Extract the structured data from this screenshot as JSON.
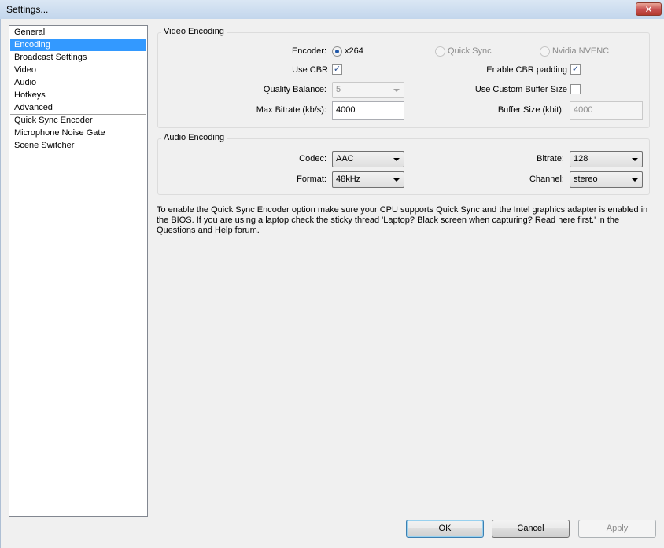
{
  "window": {
    "title": "Settings...",
    "close_glyph": "✕"
  },
  "sidebar": {
    "items": [
      {
        "label": "General"
      },
      {
        "label": "Encoding"
      },
      {
        "label": "Broadcast Settings"
      },
      {
        "label": "Video"
      },
      {
        "label": "Audio"
      },
      {
        "label": "Hotkeys"
      },
      {
        "label": "Advanced"
      },
      {
        "label": "Quick Sync Encoder"
      },
      {
        "label": "Microphone Noise Gate"
      },
      {
        "label": "Scene Switcher"
      }
    ],
    "selected_index": 1
  },
  "video_encoding": {
    "title": "Video Encoding",
    "encoder_label": "Encoder:",
    "encoder_options": [
      {
        "label": "x264",
        "selected": true,
        "enabled": true
      },
      {
        "label": "Quick Sync",
        "selected": false,
        "enabled": false
      },
      {
        "label": "Nvidia NVENC",
        "selected": false,
        "enabled": false
      }
    ],
    "use_cbr_label": "Use CBR",
    "use_cbr_checked": true,
    "enable_cbr_padding_label": "Enable CBR padding",
    "enable_cbr_padding_checked": true,
    "quality_balance_label": "Quality Balance:",
    "quality_balance_value": "5",
    "use_custom_buffer_label": "Use Custom Buffer Size",
    "use_custom_buffer_checked": false,
    "max_bitrate_label": "Max Bitrate (kb/s):",
    "max_bitrate_value": "4000",
    "buffer_size_label": "Buffer Size (kbit):",
    "buffer_size_value": "4000"
  },
  "audio_encoding": {
    "title": "Audio Encoding",
    "codec_label": "Codec:",
    "codec_value": "AAC",
    "bitrate_label": "Bitrate:",
    "bitrate_value": "128",
    "format_label": "Format:",
    "format_value": "48kHz",
    "channel_label": "Channel:",
    "channel_value": "stereo"
  },
  "note": "To enable the Quick Sync Encoder option make sure your CPU supports Quick Sync and the Intel graphics adapter is enabled in the BIOS. If you are using a laptop check the sticky thread 'Laptop? Black screen when capturing? Read here first.' in the Questions and Help forum.",
  "footer": {
    "ok_label": "OK",
    "cancel_label": "Cancel",
    "apply_label": "Apply"
  },
  "check_glyph": "✓"
}
